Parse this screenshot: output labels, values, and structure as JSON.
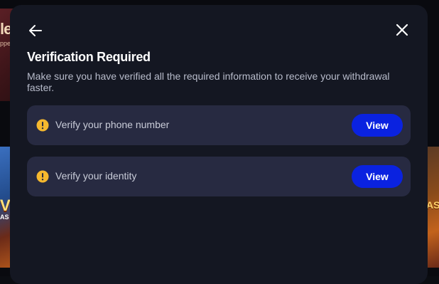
{
  "background": {
    "tile_1_text": "le",
    "tile_1_small": "ppe",
    "tile_2_text": "V",
    "tile_2_small": "AS",
    "tile_3_text": "AS"
  },
  "modal": {
    "title": "Verification Required",
    "subtitle": "Make sure you have verified all the required information to receive your withdrawal faster.",
    "back_icon": "arrow-left-icon",
    "close_icon": "close-icon",
    "items": [
      {
        "icon": "warning-icon",
        "label": "Verify your phone number",
        "button_label": "View"
      },
      {
        "icon": "warning-icon",
        "label": "Verify your identity",
        "button_label": "View"
      }
    ]
  },
  "colors": {
    "modal_bg": "#141722",
    "item_bg": "#272a41",
    "accent_button": "#0a22e0",
    "warning": "#f5b82e"
  }
}
